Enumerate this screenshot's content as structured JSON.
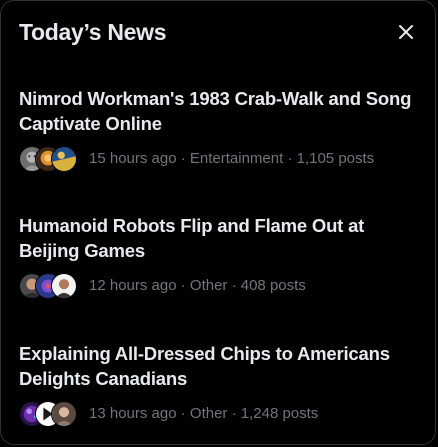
{
  "panel": {
    "title": "Today’s News",
    "close_icon": "close-icon"
  },
  "stories": [
    {
      "headline": "Nimrod Workman's 1983 Crab-Walk and Song Captivate Online",
      "meta": "15 hours ago · Entertainment · 1,105 posts",
      "avatars": [
        "avatar-grayscale-man",
        "avatar-orange-figure",
        "avatar-blue-yellow"
      ]
    },
    {
      "headline": "Humanoid Robots Flip and Flame Out at Beijing Games",
      "meta": "12 hours ago · Other · 408 posts",
      "avatars": [
        "avatar-man-portrait",
        "avatar-purple-graphic",
        "avatar-person-white"
      ]
    },
    {
      "headline": "Explaining All-Dressed Chips to Americans Delights Canadians",
      "meta": "13 hours ago · Other · 1,248 posts",
      "avatars": [
        "avatar-purple-galaxy",
        "avatar-white-logo",
        "avatar-person-portrait"
      ]
    }
  ],
  "colors": {
    "background": "#000000",
    "text_primary": "#e7e9ea",
    "text_secondary": "#71767b",
    "border": "#2f3336"
  }
}
